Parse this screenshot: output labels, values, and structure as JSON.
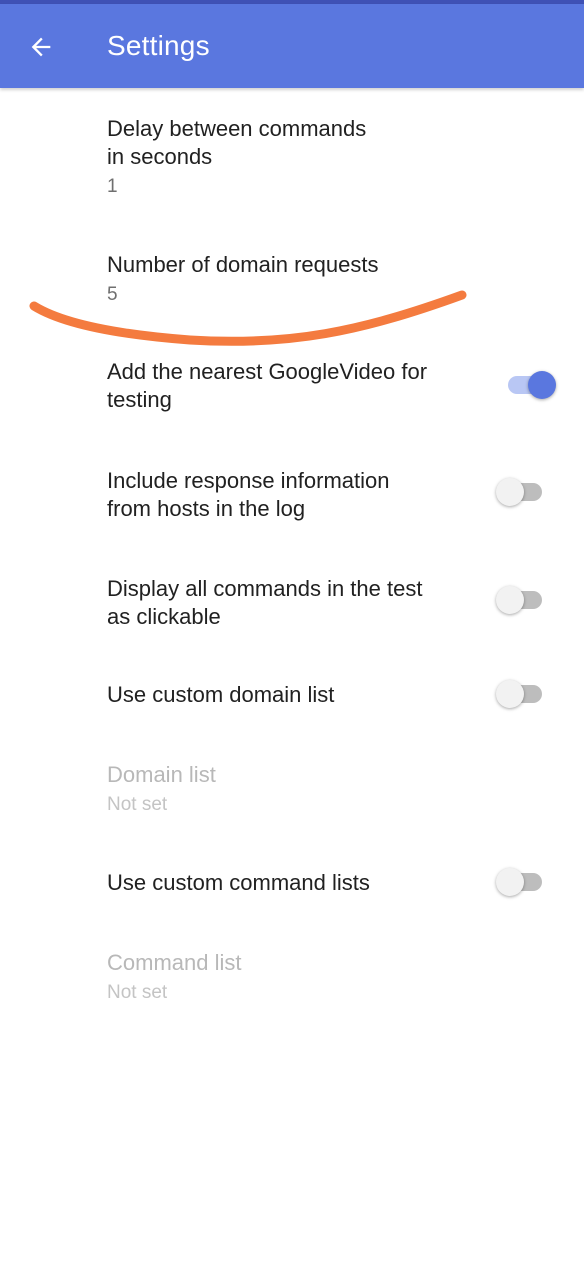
{
  "appbar": {
    "title": "Settings",
    "back_icon": "arrow-left-icon"
  },
  "colors": {
    "appbar": "#5a77df",
    "accent": "#5a77df",
    "annotation": "#f47b3f"
  },
  "preferences": [
    {
      "title": "Delay between commands\nin seconds",
      "summary": "1",
      "type": "text"
    },
    {
      "title": "Number of domain requests",
      "summary": "5",
      "type": "text"
    },
    {
      "title": "Add the nearest GoogleVideo for\ntesting",
      "type": "switch",
      "checked": true
    },
    {
      "title": "Include response information\nfrom hosts in the log",
      "type": "switch",
      "checked": false
    },
    {
      "title": "Display all commands in the test\nas clickable",
      "type": "switch",
      "checked": false
    },
    {
      "title": "Use custom domain list",
      "type": "switch",
      "checked": false
    },
    {
      "title": "Domain list",
      "summary": "Not set",
      "type": "text",
      "enabled": false
    },
    {
      "title": "Use custom command lists",
      "type": "switch",
      "checked": false
    },
    {
      "title": "Command list",
      "summary": "Not set",
      "type": "text",
      "enabled": false
    }
  ]
}
